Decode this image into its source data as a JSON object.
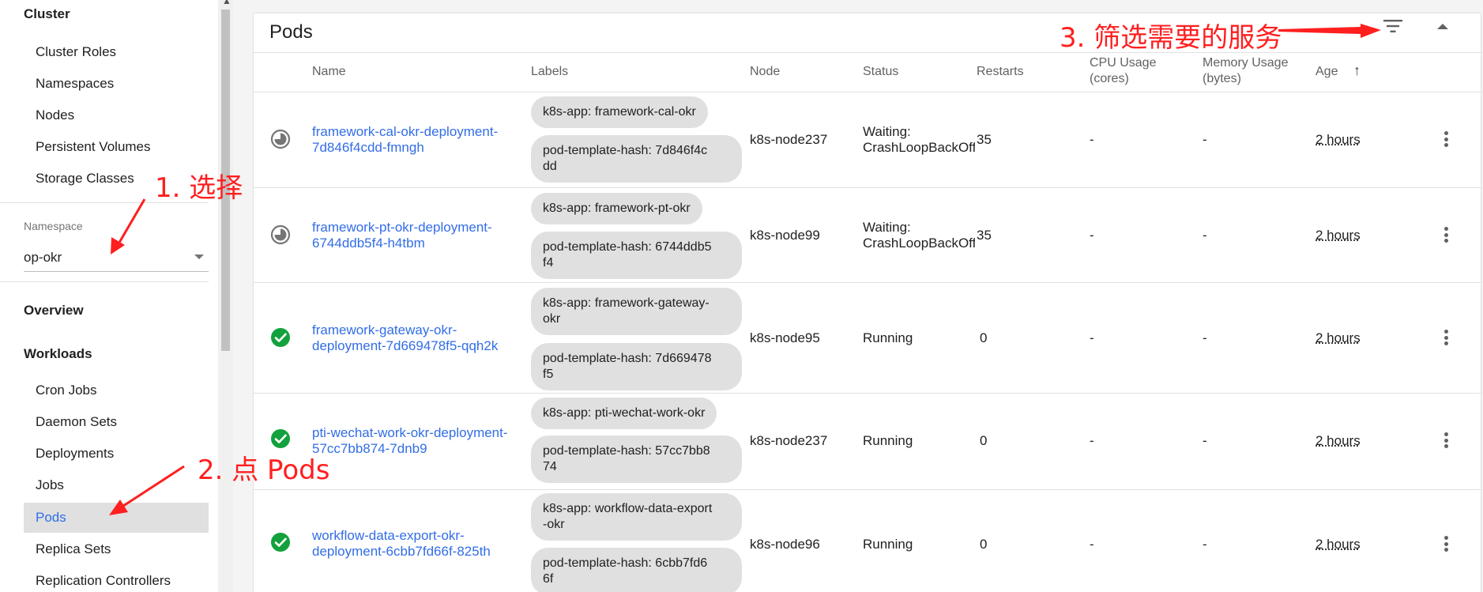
{
  "sidebar": {
    "cluster_header": "Cluster",
    "cluster_items": [
      "Cluster Roles",
      "Namespaces",
      "Nodes",
      "Persistent Volumes",
      "Storage Classes"
    ],
    "namespace_label": "Namespace",
    "namespace_value": "op-okr",
    "overview": "Overview",
    "workloads_header": "Workloads",
    "workload_items": [
      "Cron Jobs",
      "Daemon Sets",
      "Deployments",
      "Jobs",
      "Pods",
      "Replica Sets",
      "Replication Controllers"
    ],
    "active_item": "Pods"
  },
  "card": {
    "title": "Pods",
    "columns": {
      "name": "Name",
      "labels": "Labels",
      "node": "Node",
      "status": "Status",
      "restarts": "Restarts",
      "cpu_1": "CPU Usage",
      "cpu_2": "(cores)",
      "mem_1": "Memory Usage",
      "mem_2": "(bytes)",
      "age": "Age",
      "age_sort": "↑"
    }
  },
  "pods": [
    {
      "status_icon": "pending-icon",
      "name_1": "framework-cal-okr-deployment-",
      "name_2": "7d846f4cdd-fmngh",
      "label_app": "k8s-app: framework-cal-okr",
      "hash_1": "pod-template-hash: 7d846f4c",
      "hash_2": "dd",
      "node": "k8s-node237",
      "status_1": "Waiting:",
      "status_2": "CrashLoopBackOff",
      "restarts": "35",
      "cpu": "-",
      "memory": "-",
      "age": "2 hours"
    },
    {
      "status_icon": "pending-icon",
      "name_1": "framework-pt-okr-deployment-",
      "name_2": "6744ddb5f4-h4tbm",
      "label_app": "k8s-app: framework-pt-okr",
      "hash_1": "pod-template-hash: 6744ddb5",
      "hash_2": "f4",
      "node": "k8s-node99",
      "status_1": "Waiting:",
      "status_2": "CrashLoopBackOff",
      "restarts": "35",
      "cpu": "-",
      "memory": "-",
      "age": "2 hours"
    },
    {
      "status_icon": "running-check-icon",
      "name_1": "framework-gateway-okr-",
      "name_2": "deployment-7d669478f5-qqh2k",
      "label_app_1": "k8s-app: framework-gateway-",
      "label_app_2": "okr",
      "hash_1": "pod-template-hash: 7d669478",
      "hash_2": "f5",
      "node": "k8s-node95",
      "status_1": "Running",
      "restarts": "0",
      "cpu": "-",
      "memory": "-",
      "age": "2 hours"
    },
    {
      "status_icon": "running-check-icon",
      "name_1": "pti-wechat-work-okr-deployment-",
      "name_2": "57cc7bb874-7dnb9",
      "label_app": "k8s-app: pti-wechat-work-okr",
      "hash_1": "pod-template-hash: 57cc7bb8",
      "hash_2": "74",
      "node": "k8s-node237",
      "status_1": "Running",
      "restarts": "0",
      "cpu": "-",
      "memory": "-",
      "age": "2 hours"
    },
    {
      "status_icon": "running-check-icon",
      "name_1": "workflow-data-export-okr-",
      "name_2": "deployment-6cbb7fd66f-825th",
      "label_app_1": "k8s-app: workflow-data-export",
      "label_app_2": "-okr",
      "hash_1": "pod-template-hash: 6cbb7fd6",
      "hash_2": "6f",
      "node": "k8s-node96",
      "status_1": "Running",
      "restarts": "0",
      "cpu": "-",
      "memory": "-",
      "age": "2 hours"
    }
  ],
  "annotations": {
    "step1": "1. 选择",
    "step2": "2. 点 Pods",
    "step3": "3. 筛选需要的服务"
  },
  "colors": {
    "accent_link": "#326de6",
    "running_green": "#12a13c",
    "annotation_red": "#ff1f1f",
    "chip_gray": "#e0e0e0"
  }
}
